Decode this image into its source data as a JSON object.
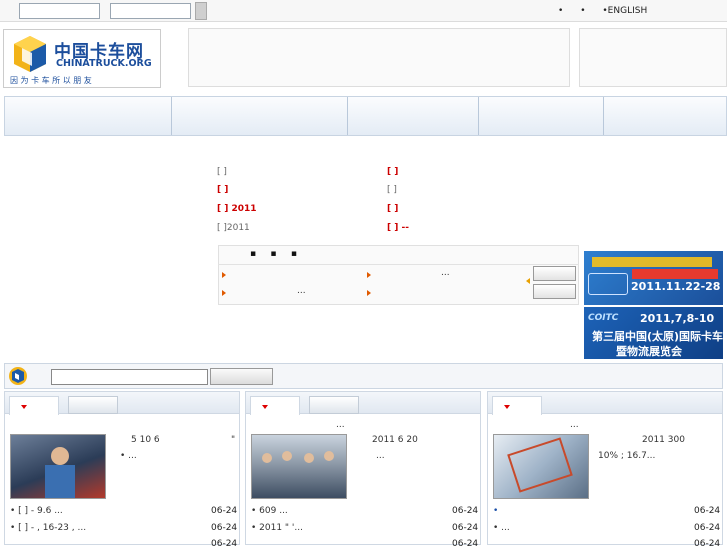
{
  "topbar": {
    "links": [
      "•",
      "•",
      "•ENGLISH"
    ]
  },
  "header": {
    "logo_cn": "中国卡车网",
    "logo_en": "CHINATRUCK.ORG",
    "slogan": "因 为 卡 车 所 以 朋 友"
  },
  "headlines": {
    "left": [
      {
        "text": "[ ]",
        "style": "gray"
      },
      {
        "text": "[   ]",
        "style": "red"
      },
      {
        "text": "[   ]     2011",
        "style": "red"
      },
      {
        "text": "[ ]2011",
        "style": "gray"
      }
    ],
    "right": [
      {
        "text": "[   ]",
        "style": "red"
      },
      {
        "text": "[ ]",
        "style": "gray"
      },
      {
        "text": "[   ]",
        "style": "red"
      },
      {
        "text": "[   ]        --",
        "style": "red"
      }
    ]
  },
  "newsbox": {
    "tabs": [
      "▪",
      "▪",
      "▪"
    ],
    "row1_mid": "...",
    "row2_mid": "..."
  },
  "ads": {
    "ad1_line1": "2011.11.22-28",
    "ad2_line1": "2011,7,8-10",
    "ad2_line2": "第三届中国(太原)国际卡车",
    "ad2_line3": "暨物流展览会",
    "ad2_logo": "COITC"
  },
  "columns": [
    {
      "heading_dots": "",
      "summary": [
        "5 10   6",
        "\"",
        "•   ..."
      ],
      "items": [
        {
          "text": "•  [ ]  -    9.6      ...",
          "date": "06-24"
        },
        {
          "text": "•  [ ]  -    ,   16-23 , ...",
          "date": "06-24"
        },
        {
          "text": "",
          "date": "06-24"
        }
      ]
    },
    {
      "heading_dots": "...",
      "summary": [
        "2011 6 20",
        "...",
        ""
      ],
      "items": [
        {
          "text": "•      609          ...",
          "date": "06-24"
        },
        {
          "text": "•      2011         \"   '...",
          "date": "06-24"
        },
        {
          "text": "",
          "date": "06-24"
        }
      ]
    },
    {
      "heading_dots": "...",
      "summary": [
        "2011      300",
        "10%   ;         16.7...",
        ""
      ],
      "items": [
        {
          "text": "•",
          "date": "06-24"
        },
        {
          "text": "•             ...",
          "date": "06-24"
        },
        {
          "text": "",
          "date": "06-24"
        }
      ]
    }
  ]
}
